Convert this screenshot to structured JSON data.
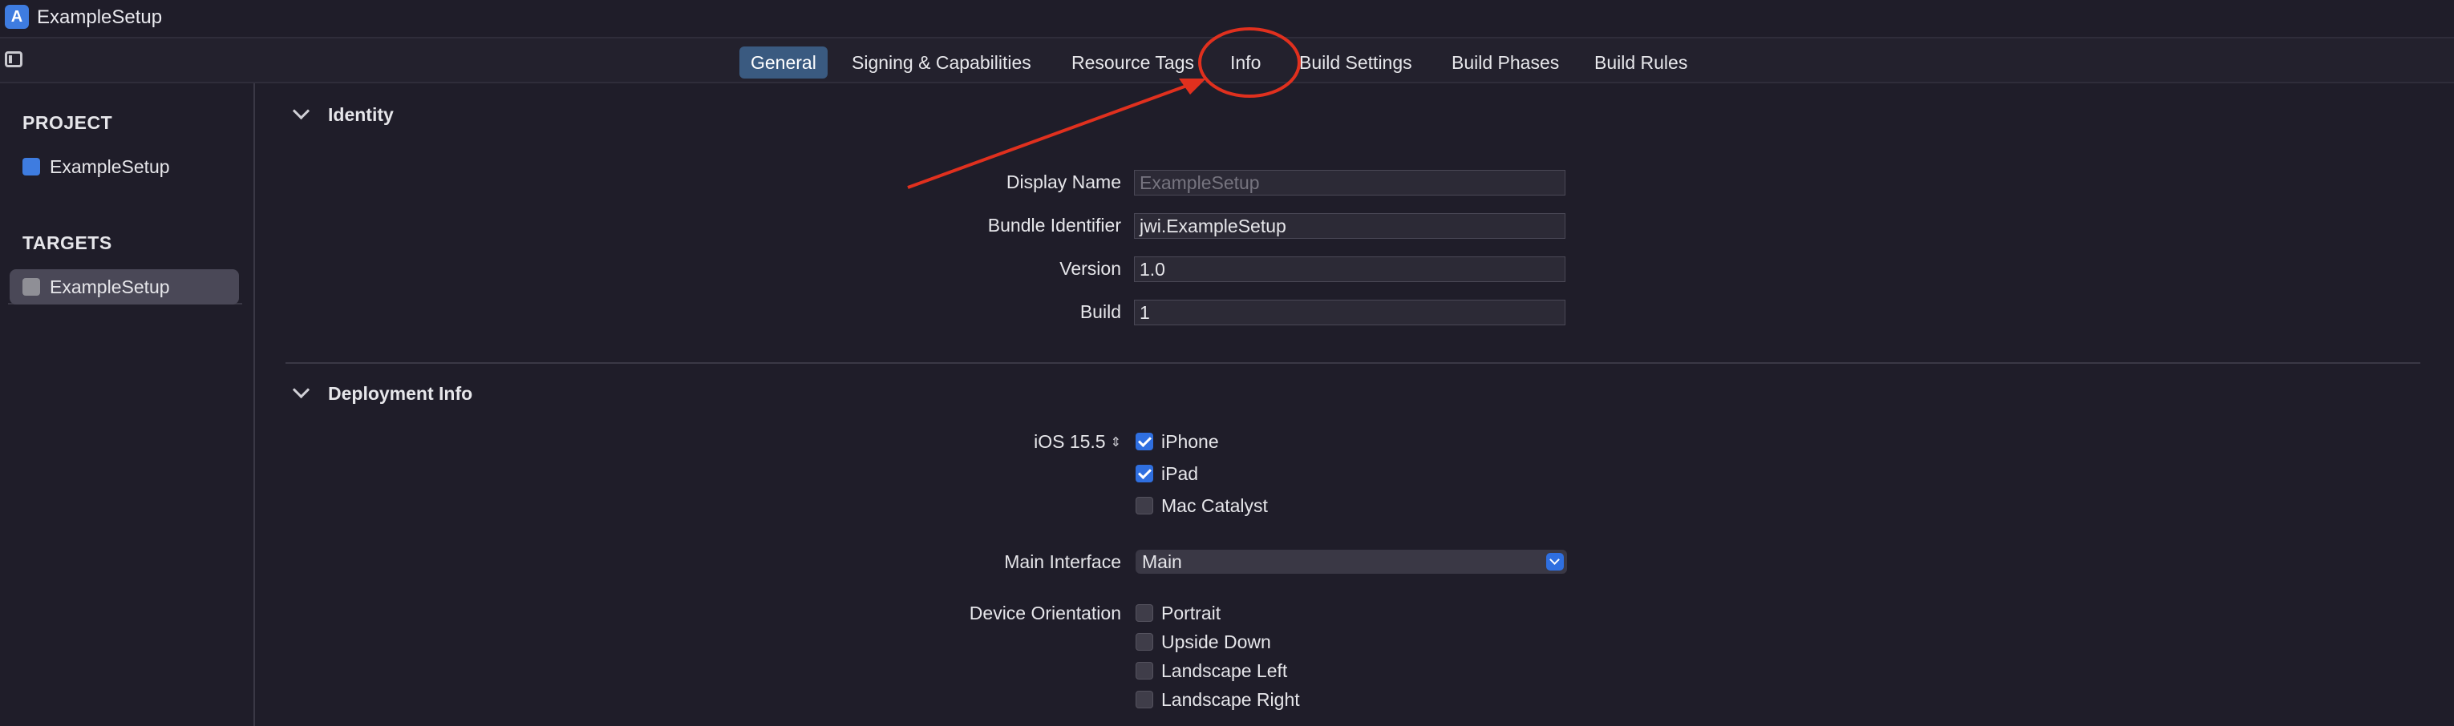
{
  "app": {
    "title": "ExampleSetup"
  },
  "tabs": [
    {
      "label": "General",
      "active": true
    },
    {
      "label": "Signing & Capabilities"
    },
    {
      "label": "Resource Tags"
    },
    {
      "label": "Info"
    },
    {
      "label": "Build Settings"
    },
    {
      "label": "Build Phases"
    },
    {
      "label": "Build Rules"
    }
  ],
  "sidebar": {
    "project_header": "PROJECT",
    "project_item": "ExampleSetup",
    "targets_header": "TARGETS",
    "target_item": "ExampleSetup"
  },
  "identity": {
    "title": "Identity",
    "display_name_label": "Display Name",
    "display_name_placeholder": "ExampleSetup",
    "bundle_label": "Bundle Identifier",
    "bundle_value": "jwi.ExampleSetup",
    "version_label": "Version",
    "version_value": "1.0",
    "build_label": "Build",
    "build_value": "1"
  },
  "deployment": {
    "title": "Deployment Info",
    "ios_label": "iOS 15.5",
    "devices": [
      {
        "label": "iPhone",
        "checked": true
      },
      {
        "label": "iPad",
        "checked": true
      },
      {
        "label": "Mac Catalyst",
        "checked": false
      }
    ],
    "main_interface_label": "Main Interface",
    "main_interface_value": "Main",
    "orientation_label": "Device Orientation",
    "orientations": [
      {
        "label": "Portrait",
        "checked": false
      },
      {
        "label": "Upside Down",
        "checked": false
      },
      {
        "label": "Landscape Left",
        "checked": false
      },
      {
        "label": "Landscape Right",
        "checked": false
      }
    ]
  },
  "colors": {
    "accent": "#2f6fe0",
    "annotation": "#e0301e",
    "active_tab": "#3a5a80"
  }
}
